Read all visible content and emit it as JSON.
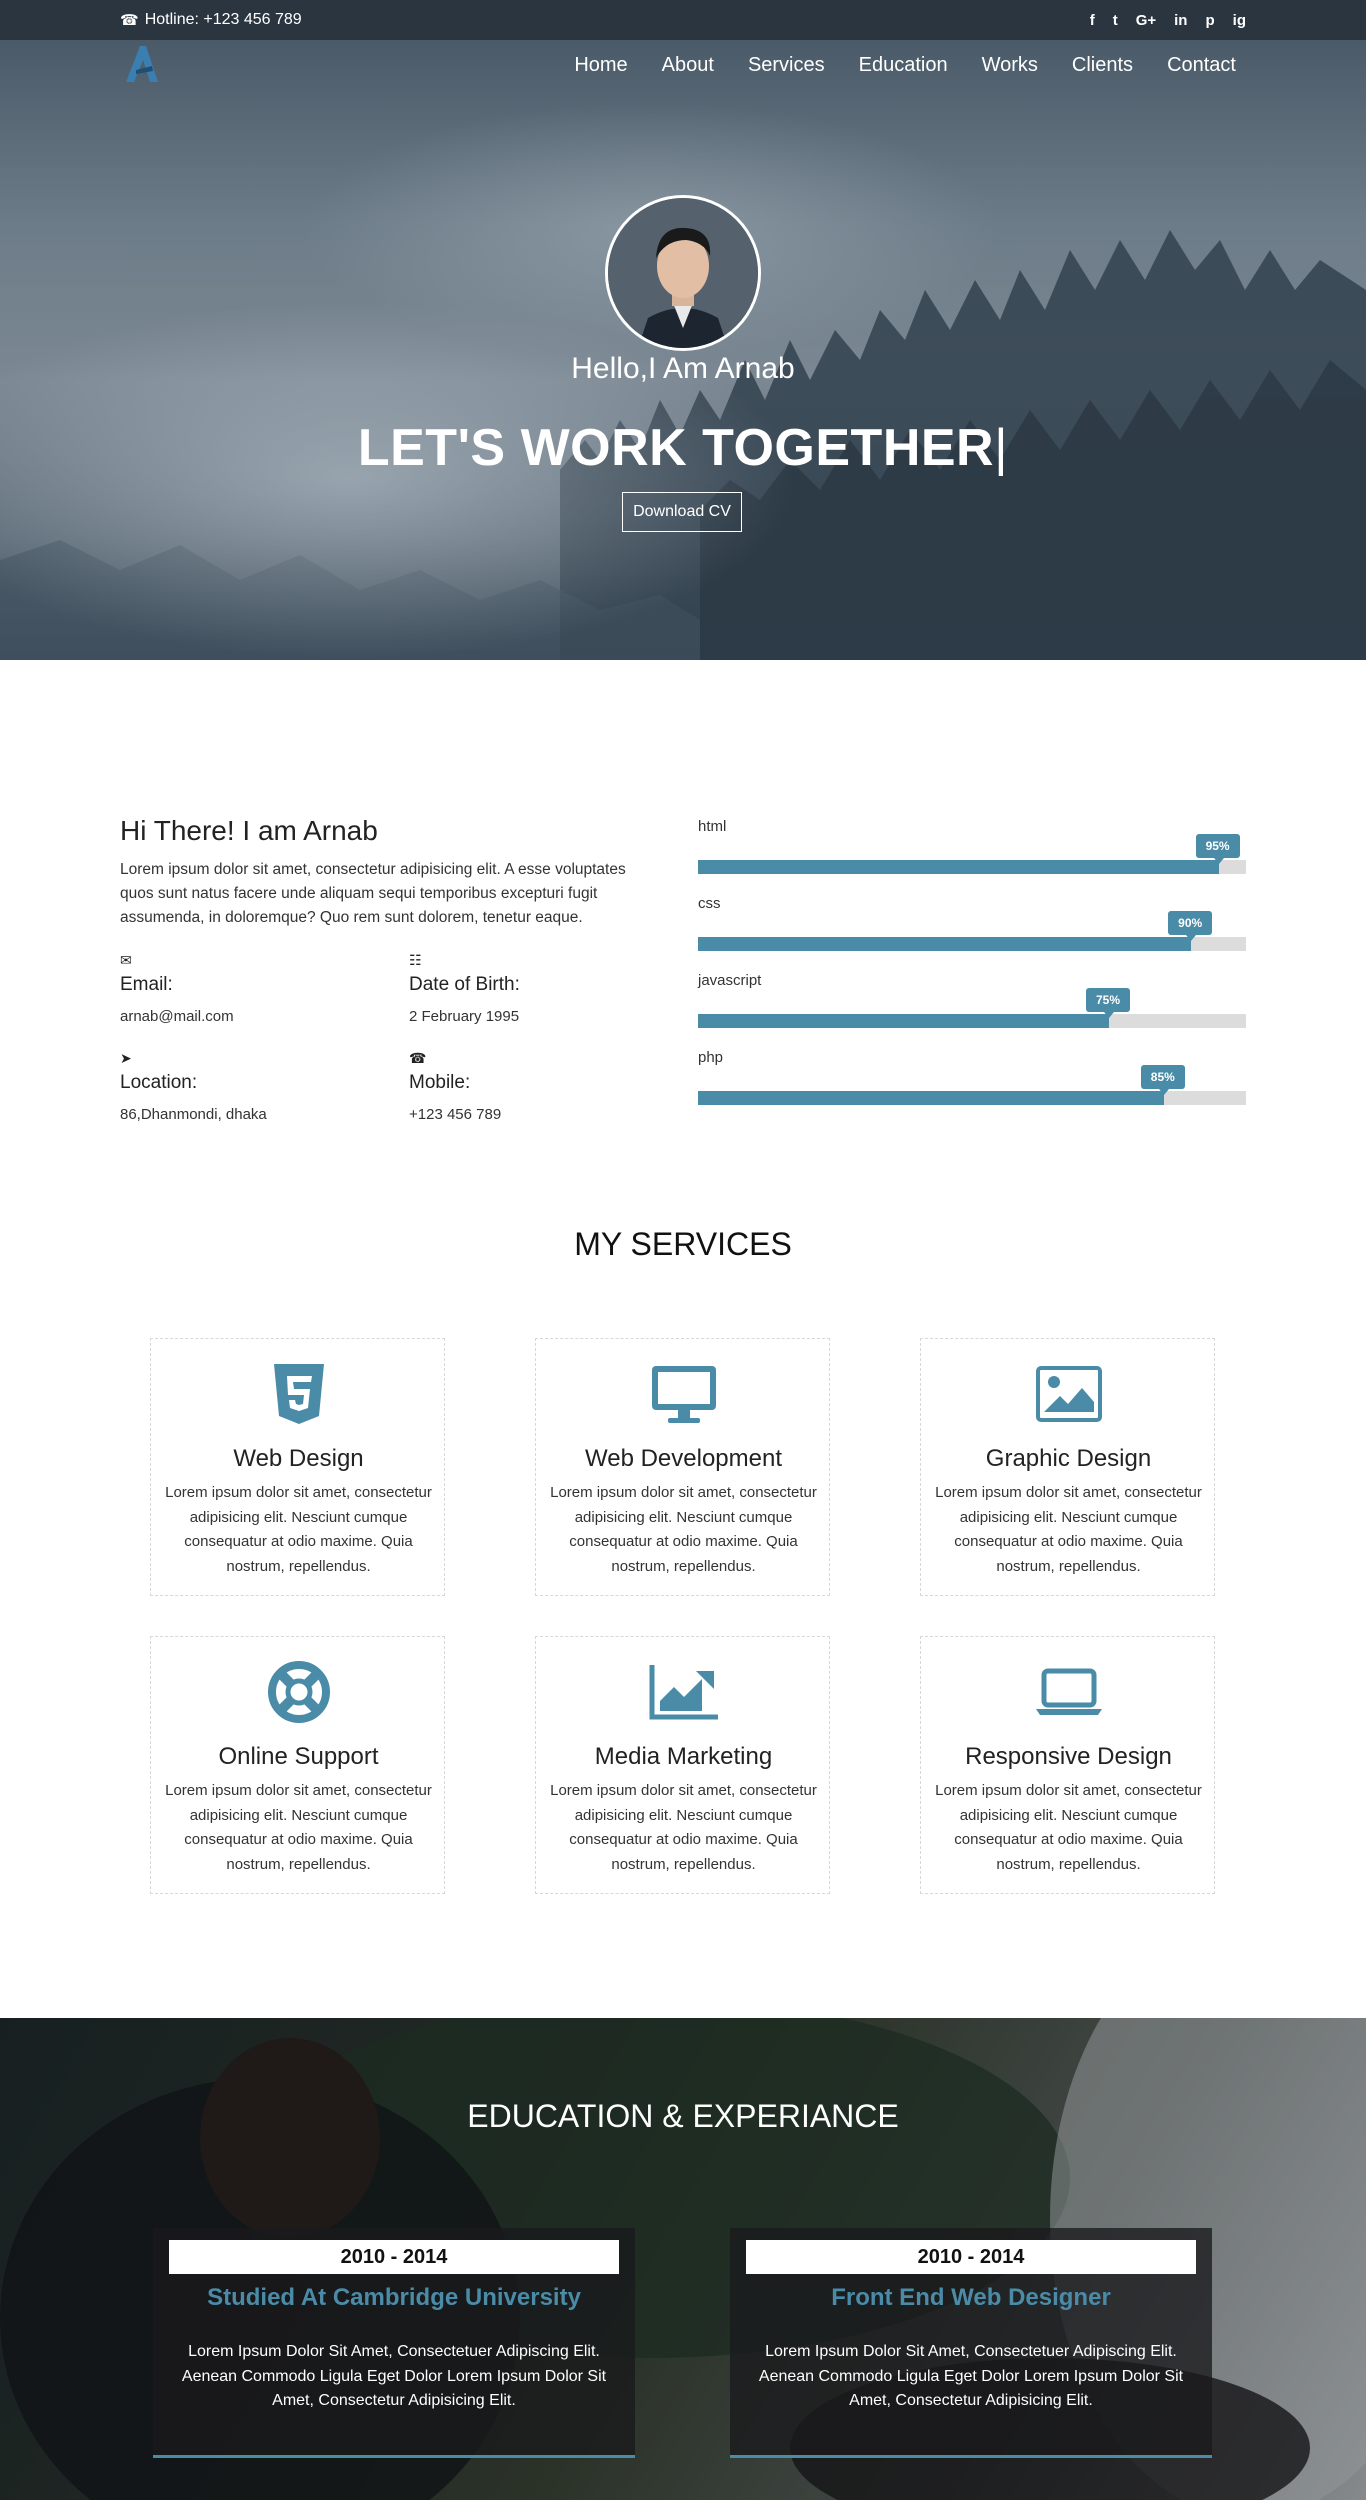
{
  "topbar": {
    "hotline": "Hotline: +123 456 789",
    "social": [
      "f",
      "t",
      "G+",
      "in",
      "p",
      "ig"
    ]
  },
  "nav": {
    "items": [
      "Home",
      "About",
      "Services",
      "Education",
      "Works",
      "Clients",
      "Contact"
    ]
  },
  "hero": {
    "greeting": "Hello,I Am Arnab",
    "headline": "LET'S WORK TOGETHER",
    "caret": "|",
    "cta": "Download CV"
  },
  "about": {
    "title": "Hi There! I am Arnab",
    "text": "Lorem ipsum dolor sit amet, consectetur adipisicing elit. A esse voluptates quos sunt natus facere unde aliquam sequi temporibus excepturi fugit assumenda, in doloremque? Quo rem sunt dolorem, tenetur eaque.",
    "email_label": "Email:",
    "email": "arnab@mail.com",
    "dob_label": "Date of Birth:",
    "dob": "2 February 1995",
    "location_label": "Location:",
    "location": "86,Dhanmondi, dhaka",
    "mobile_label": "Mobile:",
    "mobile": "+123 456 789"
  },
  "skills": [
    {
      "name": "html",
      "percent": 95,
      "label": "95%"
    },
    {
      "name": "css",
      "percent": 90,
      "label": "90%"
    },
    {
      "name": "javascript",
      "percent": 75,
      "label": "75%"
    },
    {
      "name": "php",
      "percent": 85,
      "label": "85%"
    }
  ],
  "services": {
    "title": "MY SERVICES",
    "items": [
      {
        "title": "Web Design",
        "text": "Lorem ipsum dolor sit amet, consectetur adipisicing elit. Nesciunt cumque consequatur at odio maxime. Quia nostrum, repellendus.",
        "icon": "html5-icon"
      },
      {
        "title": "Web Development",
        "text": "Lorem ipsum dolor sit amet, consectetur adipisicing elit. Nesciunt cumque consequatur at odio maxime. Quia nostrum, repellendus.",
        "icon": "desktop-icon"
      },
      {
        "title": "Graphic Design",
        "text": "Lorem ipsum dolor sit amet, consectetur adipisicing elit. Nesciunt cumque consequatur at odio maxime. Quia nostrum, repellendus.",
        "icon": "image-icon"
      },
      {
        "title": "Online Support",
        "text": "Lorem ipsum dolor sit amet, consectetur adipisicing elit. Nesciunt cumque consequatur at odio maxime. Quia nostrum, repellendus.",
        "icon": "lifebuoy-icon"
      },
      {
        "title": "Media Marketing",
        "text": "Lorem ipsum dolor sit amet, consectetur adipisicing elit. Nesciunt cumque consequatur at odio maxime. Quia nostrum, repellendus.",
        "icon": "area-chart-icon"
      },
      {
        "title": "Responsive Design",
        "text": "Lorem ipsum dolor sit amet, consectetur adipisicing elit. Nesciunt cumque consequatur at odio maxime. Quia nostrum, repellendus.",
        "icon": "laptop-icon"
      }
    ]
  },
  "education": {
    "title": "EDUCATION & EXPERIANCE",
    "items": [
      {
        "years": "2010 - 2014",
        "title": "Studied At Cambridge University",
        "text": "Lorem Ipsum Dolor Sit Amet, Consectetuer Adipiscing Elit. Aenean Commodo Ligula Eget Dolor Lorem Ipsum Dolor Sit Amet, Consectetur Adipisicing Elit."
      },
      {
        "years": "2010 - 2014",
        "title": "Front End Web Designer",
        "text": "Lorem Ipsum Dolor Sit Amet, Consectetuer Adipiscing Elit. Aenean Commodo Ligula Eget Dolor Lorem Ipsum Dolor Sit Amet, Consectetur Adipisicing Elit."
      }
    ]
  },
  "colors": {
    "accent": "#4a8ba8",
    "topbar": "#2b3540"
  }
}
